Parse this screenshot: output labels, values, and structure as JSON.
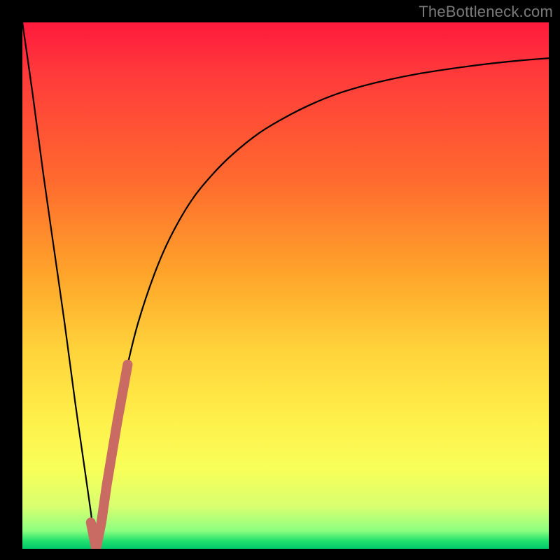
{
  "watermark": {
    "text": "TheBottleneck.com"
  },
  "colors": {
    "background": "#000000",
    "curve": "#000000",
    "highlight": "#c96a63",
    "gradient_top": "#ff1a3c",
    "gradient_bottom": "#00c96a"
  },
  "chart_data": {
    "type": "line",
    "title": "",
    "xlabel": "",
    "ylabel": "",
    "xlim": [
      0,
      100
    ],
    "ylim": [
      0,
      100
    ],
    "grid": false,
    "legend": false,
    "series": [
      {
        "name": "bottleneck-curve",
        "x": [
          0,
          2,
          4,
          6,
          8,
          10,
          12,
          13,
          14,
          15,
          16,
          18,
          20,
          22,
          25,
          28,
          32,
          36,
          40,
          45,
          50,
          55,
          60,
          65,
          70,
          75,
          80,
          85,
          90,
          95,
          100
        ],
        "values": [
          100,
          86,
          71,
          57,
          43,
          28,
          14,
          7,
          0,
          7,
          14,
          25,
          35,
          43,
          52,
          59,
          66,
          71,
          75,
          79,
          82,
          84.5,
          86.5,
          88,
          89.2,
          90.2,
          91,
          91.7,
          92.3,
          92.8,
          93.2
        ]
      },
      {
        "name": "highlight-segment",
        "x": [
          13,
          14,
          15,
          16,
          18,
          20
        ],
        "values": [
          5,
          0,
          5,
          12,
          24,
          35
        ]
      }
    ],
    "annotations": []
  }
}
